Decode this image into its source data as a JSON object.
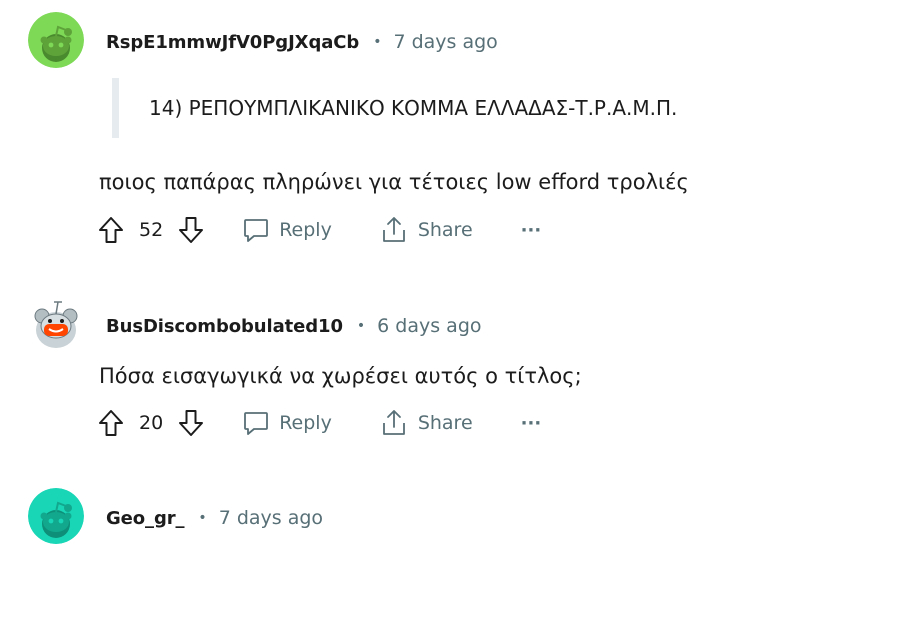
{
  "comments": [
    {
      "author": "RspE1mmwJfV0PgJXqaCb",
      "time": "7 days ago",
      "avatar_color": "#7ed957",
      "quote": "14) ΡΕΠΟΥΜΠΛΙΚΑΝΙΚΟ ΚΟΜΜΑ ΕΛΛΑΔΑΣ-Τ.Ρ.Α.Μ.Π.",
      "body": "ποιος παπάρας πληρώνει για τέτοιες low efford τρολιές",
      "score": "52",
      "reply_label": "Reply",
      "share_label": "Share",
      "more_label": "···"
    },
    {
      "author": "BusDiscombobulated10",
      "time": "6 days ago",
      "body": "Πόσα εισαγωγικά να χωρέσει αυτός ο τίτλος;",
      "score": "20",
      "reply_label": "Reply",
      "share_label": "Share",
      "more_label": "···"
    },
    {
      "author": "Geo_gr_",
      "time": "7 days ago",
      "avatar_color": "#19d6b6"
    }
  ],
  "separator": "•",
  "colors": {
    "meta": "#576f76",
    "text": "#1c1c1c",
    "quote_bar": "#e5ebee"
  },
  "icons": [
    "upvote-icon",
    "downvote-icon",
    "comment-bubble-icon",
    "share-icon",
    "more-icon"
  ]
}
